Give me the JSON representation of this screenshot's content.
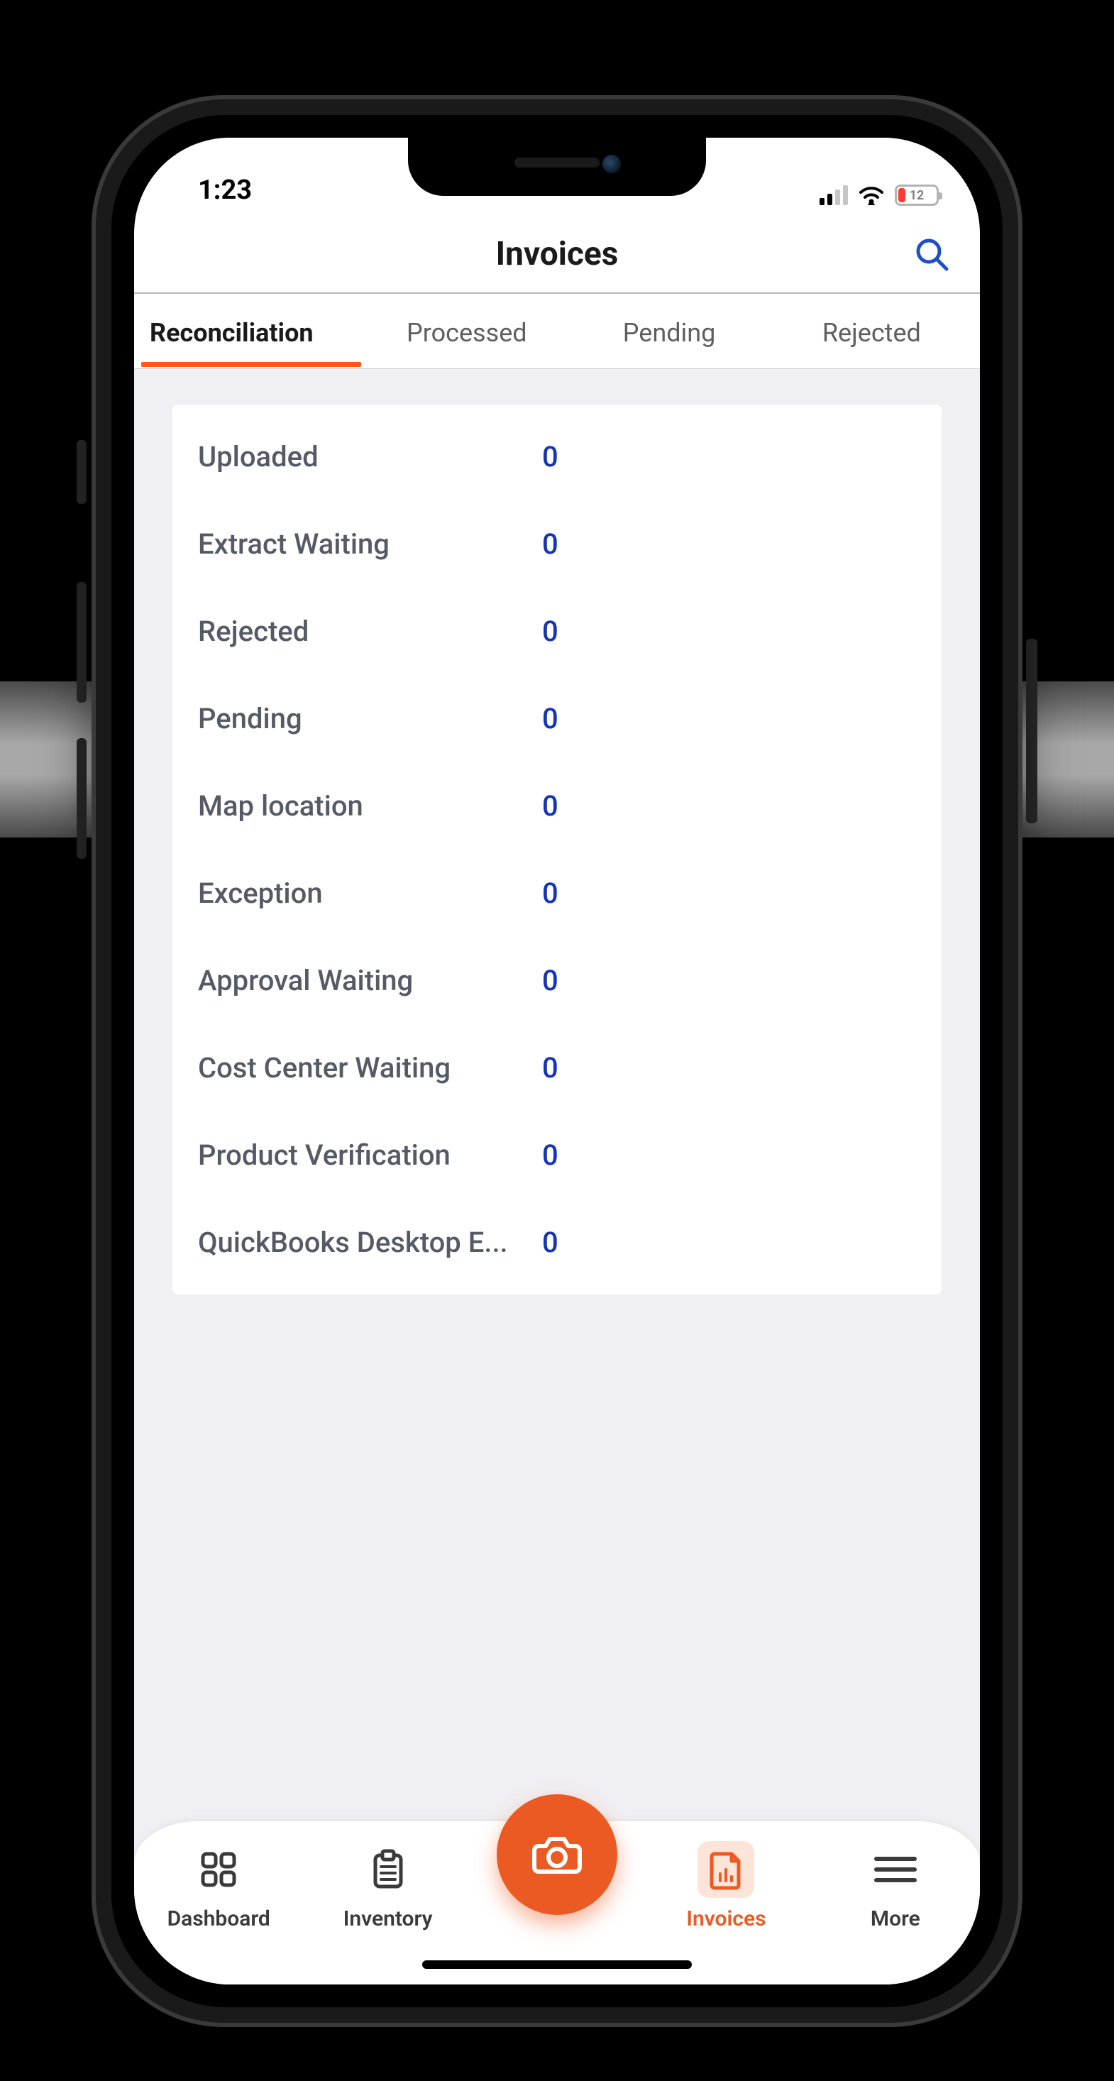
{
  "status": {
    "time": "1:23",
    "battery_pct": "12"
  },
  "header": {
    "title": "Invoices"
  },
  "tabs": [
    {
      "label": "Reconciliation",
      "active": true
    },
    {
      "label": "Processed",
      "active": false
    },
    {
      "label": "Pending",
      "active": false
    },
    {
      "label": "Rejected",
      "active": false
    }
  ],
  "stats": [
    {
      "label": "Uploaded",
      "value": "0"
    },
    {
      "label": "Extract Waiting",
      "value": "0"
    },
    {
      "label": "Rejected",
      "value": "0"
    },
    {
      "label": "Pending",
      "value": "0"
    },
    {
      "label": "Map location",
      "value": "0"
    },
    {
      "label": "Exception",
      "value": "0"
    },
    {
      "label": "Approval Waiting",
      "value": "0"
    },
    {
      "label": "Cost Center Waiting",
      "value": "0"
    },
    {
      "label": "Product Verification",
      "value": "0"
    },
    {
      "label": "QuickBooks Desktop E...",
      "value": "0"
    }
  ],
  "nav": {
    "dashboard": "Dashboard",
    "inventory": "Inventory",
    "invoices": "Invoices",
    "more": "More"
  },
  "colors": {
    "accent": "#ec5a24",
    "link": "#1634b7"
  }
}
